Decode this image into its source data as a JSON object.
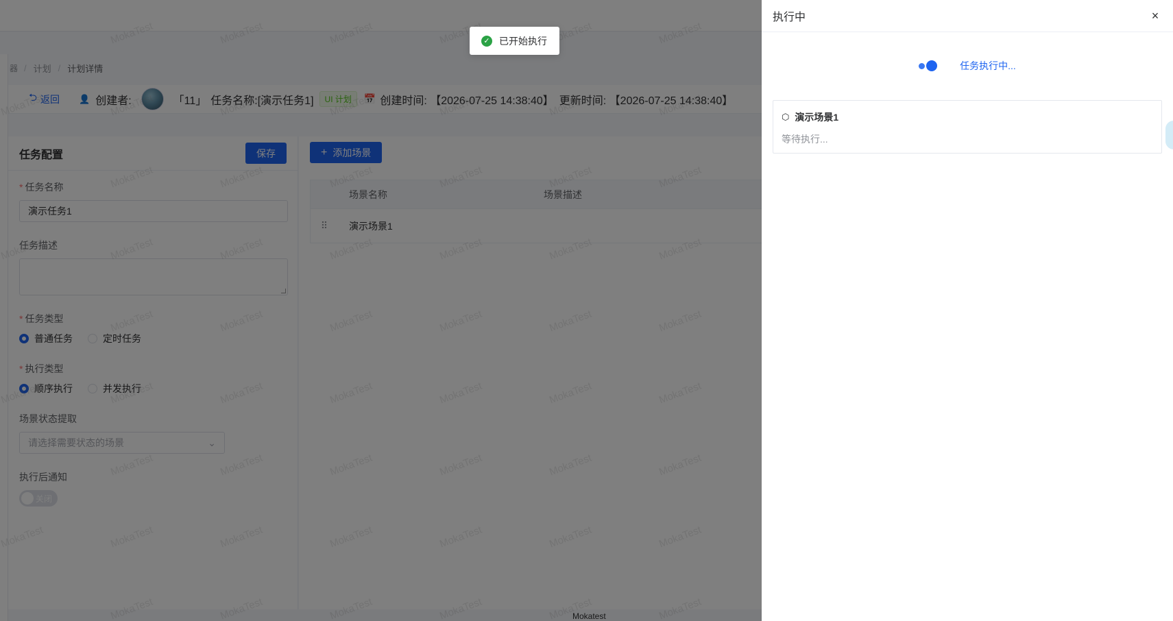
{
  "breadcrumb": {
    "home": "器",
    "items": [
      "计划",
      "计划详情"
    ]
  },
  "info_bar": {
    "back_label": "返回",
    "creator_label": "创建者:",
    "id_text": "「11」",
    "task_name_text": "任务名称:[演示任务1]",
    "tag": "UI 计划",
    "created_text": "创建时间: 【2026-07-25 14:38:40】",
    "updated_text": "更新时间: 【2026-07-25 14:38:40】"
  },
  "task_config": {
    "title": "任务配置",
    "save_label": "保存",
    "name_label": "任务名称",
    "name_value": "演示任务1",
    "desc_label": "任务描述",
    "desc_value": "",
    "type_label": "任务类型",
    "type_options": [
      "普通任务",
      "定时任务"
    ],
    "type_selected": "普通任务",
    "exec_label": "执行类型",
    "exec_options": [
      "顺序执行",
      "并发执行"
    ],
    "exec_selected": "顺序执行",
    "scene_state_label": "场景状态提取",
    "scene_state_placeholder": "请选择需要状态的场景",
    "notify_label": "执行后通知",
    "notify_switch_text": "关闭",
    "notify_on": false
  },
  "scene_list": {
    "add_label": "添加场景",
    "columns": [
      "场景名称",
      "场景描述"
    ],
    "rows": [
      {
        "name": "演示场景1",
        "desc": ""
      }
    ]
  },
  "footer": "Mokatest",
  "watermark_text": "MokaTest",
  "toast": {
    "message": "已开始执行",
    "type": "success"
  },
  "drawer": {
    "title": "执行中",
    "close_glyph": "×",
    "status_text": "任务执行中...",
    "scene_card": {
      "name": "演示场景1",
      "status": "等待执行..."
    }
  },
  "colors": {
    "primary": "#1e64f0",
    "success": "#2ba245",
    "mask": "rgba(0,0,0,0.5)"
  }
}
